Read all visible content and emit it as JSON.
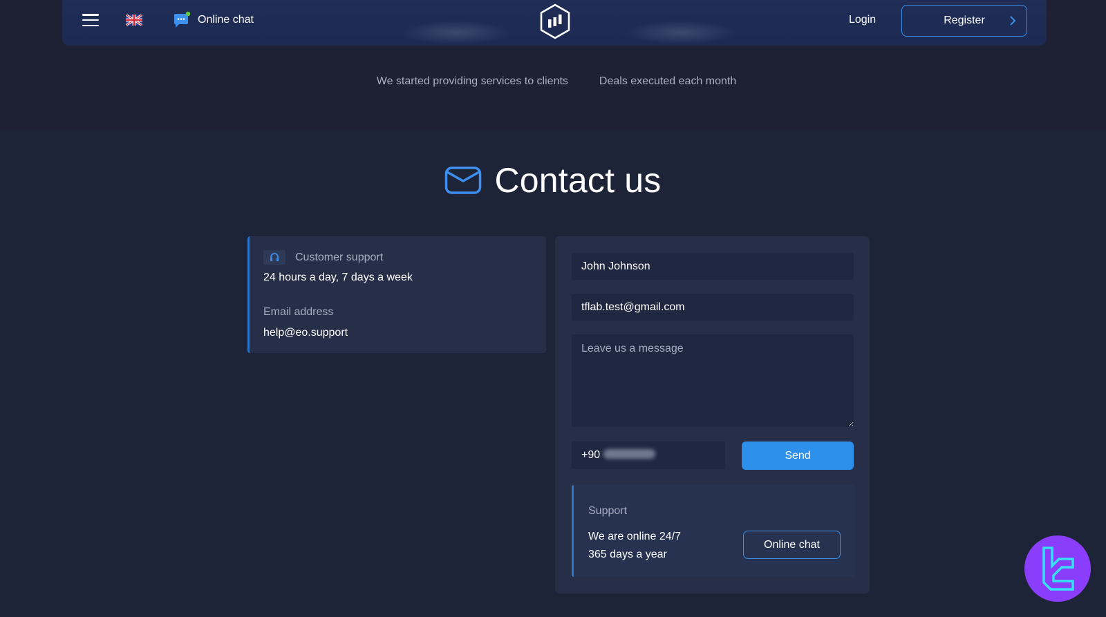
{
  "header": {
    "menu_icon": "hamburger-icon",
    "language_flag": "uk-flag-icon",
    "online_chat_label": "Online chat",
    "online_chat_icon": "chat-bubble-icon",
    "logo_icon": "hexagon-chart-logo",
    "login_label": "Login",
    "register_label": "Register",
    "register_icon": "chevron-right-icon"
  },
  "stats": {
    "items": [
      "We started providing services to clients",
      "Deals executed each month"
    ]
  },
  "contact": {
    "title": "Contact us",
    "title_icon": "envelope-icon",
    "info": {
      "support_icon": "headset-icon",
      "support_label": "Customer support",
      "support_hours": "24 hours a day, 7 days a week",
      "email_label": "Email address",
      "email_value": "help@eo.support"
    },
    "form": {
      "name_value": "John Johnson",
      "email_value": "tflab.test@gmail.com",
      "message_placeholder": "Leave us a message",
      "message_value": "",
      "phone_prefix": "+90",
      "send_label": "Send"
    },
    "support_box": {
      "title": "Support",
      "line1": "We are online 24/7",
      "line2": "365 days a year",
      "chat_button_label": "Online chat"
    }
  },
  "colors": {
    "accent": "#2d90ea",
    "border_accent": "#3b8fe6",
    "background": "#1e2438",
    "card": "#272f48",
    "badge": "#8b3dfc"
  }
}
